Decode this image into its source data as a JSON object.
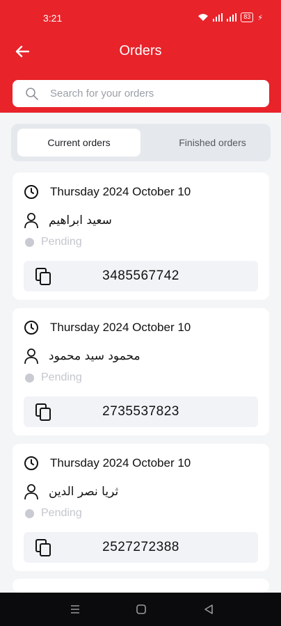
{
  "status_bar": {
    "time": "3:21",
    "battery": "83"
  },
  "header": {
    "title": "Orders"
  },
  "search": {
    "placeholder": "Search for your orders"
  },
  "tabs": [
    {
      "label": "Current orders",
      "active": true
    },
    {
      "label": "Finished orders",
      "active": false
    }
  ],
  "orders": [
    {
      "date": "Thursday 2024 October 10",
      "customer": "سعيد ابراهيم",
      "status": "Pending",
      "order_number": "3485567742"
    },
    {
      "date": "Thursday 2024 October 10",
      "customer": "محمود سيد محمود",
      "status": "Pending",
      "order_number": "2735537823"
    },
    {
      "date": "Thursday 2024 October 10",
      "customer": "ثريا نصر الدين",
      "status": "Pending",
      "order_number": "2527272388"
    }
  ],
  "colors": {
    "accent": "#e8232a",
    "background": "#f3f5f7",
    "pending_dot": "#c8cbd2"
  },
  "icons": [
    "back-arrow-icon",
    "search-icon",
    "clock-icon",
    "user-icon",
    "copy-icon",
    "wifi-icon",
    "signal-icon",
    "battery-icon",
    "menu-nav-icon",
    "home-nav-icon",
    "back-nav-icon"
  ]
}
